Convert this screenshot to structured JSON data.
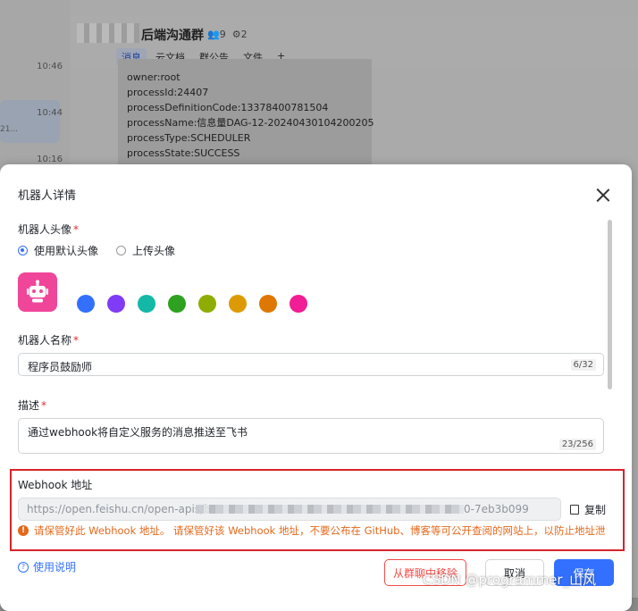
{
  "background": {
    "timestamps": [
      "10:46",
      "10:44",
      "10:16"
    ],
    "selected_preview": "21...",
    "group_title": "后端沟通群",
    "member_count": "9",
    "bot_count": "2",
    "tabs": [
      "消息",
      "云文档",
      "群公告",
      "文件",
      "+"
    ],
    "message_lines": [
      "owner:root",
      "processId:24407",
      "processDefinitionCode:13378400781504",
      "processName:信息量DAG-12-20240430104200205",
      "processType:SCHEDULER",
      "processState:SUCCESS"
    ]
  },
  "modal": {
    "title": "机器人详情",
    "avatar_label": "机器人头像",
    "avatar_options": [
      "使用默认头像",
      "上传头像"
    ],
    "avatar_color": "#f0469a",
    "swatch_colors": [
      "#3370ff",
      "#7f3bf5",
      "#14b8a6",
      "#2ea121",
      "#8fac02",
      "#dc9b04",
      "#de7802",
      "#f01d94"
    ],
    "name_label": "机器人名称",
    "name_value": "程序员鼓励师",
    "name_counter": "6/32",
    "desc_label": "描述",
    "desc_value": "通过webhook将自定义服务的消息推送至飞书",
    "desc_counter": "23/256",
    "webhook_label": "Webhook 地址",
    "webhook_url_start": "https://open.feishu.cn/open-apis/b",
    "webhook_url_end": "0-7eb3b099",
    "copy_label": "复制",
    "warning": "请保管好此 Webhook 地址。 请保管好该 Webhook 地址，不要公布在 GitHub、博客等可公开查阅的网站上，以防止地址泄",
    "help_label": "使用说明",
    "remove_label": "从群聊中移除",
    "cancel_label": "取消",
    "save_label": "保存"
  },
  "watermark": "CSDN @programmer_山风"
}
